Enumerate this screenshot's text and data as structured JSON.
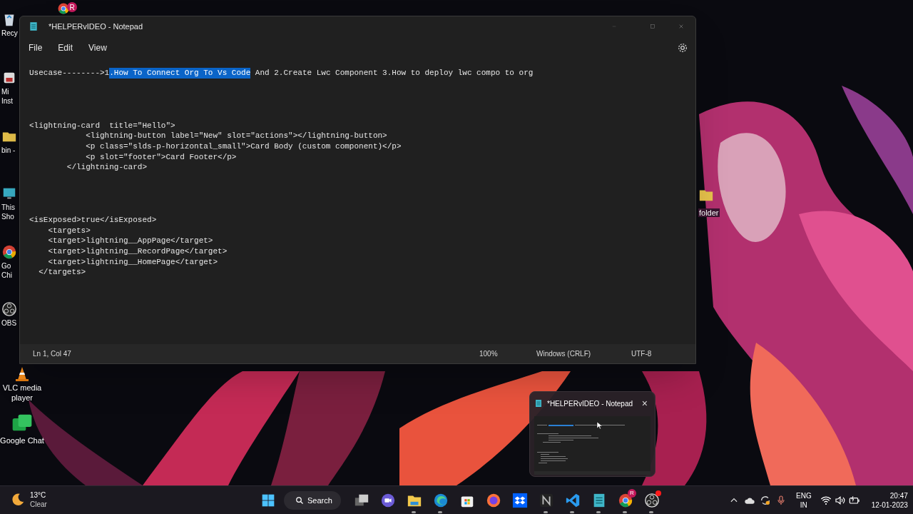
{
  "desktop_icons": [
    {
      "kind": "recycle",
      "label": "Recy"
    },
    {
      "kind": "installer",
      "label": "Mi\nInst"
    },
    {
      "kind": "folder",
      "label": "bin -"
    },
    {
      "kind": "pc",
      "label": "This\nSho"
    },
    {
      "kind": "chrome",
      "label": "Go\nChi"
    },
    {
      "kind": "obs",
      "label": "OBS"
    },
    {
      "kind": "vlc",
      "label": "VLC media\nplayer"
    },
    {
      "kind": "chat",
      "label": "Google Chat"
    }
  ],
  "desktop_chrome_badge": "R",
  "desktop_folder_label": "folder",
  "window": {
    "title": "*HELPERvIDEO - Notepad",
    "menu": [
      "File",
      "Edit",
      "View"
    ],
    "editor": {
      "first_line": [
        {
          "text": "Usecase-------->1",
          "selected": false
        },
        {
          "text": ".How To Connect Org To Vs Code",
          "selected": true
        },
        {
          "text": " And 2.Create Lwc Component 3.How to deploy lwc compo to org",
          "selected": false
        }
      ],
      "blocks": [
        [
          "<lightning-card  title=\"Hello\">",
          "            <lightning-button label=\"New\" slot=\"actions\"></lightning-button>",
          "            <p class=\"slds-p-horizontal_small\">Card Body (custom component)</p>",
          "            <p slot=\"footer\">Card Footer</p>",
          "        </lightning-card>"
        ],
        [
          "<isExposed>true</isExposed>",
          "    <targets>",
          "    <target>lightning__AppPage</target>",
          "    <target>lightning__RecordPage</target>",
          "    <target>lightning__HomePage</target>",
          "  </targets>"
        ]
      ]
    },
    "status_bar": {
      "position": "Ln 1, Col 47",
      "zoom": "100%",
      "line_ending": "Windows (CRLF)",
      "encoding": "UTF-8"
    }
  },
  "preview": {
    "title": "*HELPERvIDEO - Notepad",
    "close": "×"
  },
  "taskbar": {
    "weather": {
      "temp": "13°C",
      "condition": "Clear"
    },
    "search": "Search",
    "apps": [
      {
        "kind": "taskview",
        "running": false
      },
      {
        "kind": "meet",
        "running": false
      },
      {
        "kind": "explorer",
        "running": true
      },
      {
        "kind": "edge",
        "running": true
      },
      {
        "kind": "store",
        "running": false
      },
      {
        "kind": "firefox",
        "running": false
      },
      {
        "kind": "dropbox",
        "running": false
      },
      {
        "kind": "napp",
        "running": true
      },
      {
        "kind": "vscode",
        "running": true
      },
      {
        "kind": "notepad",
        "running": true
      },
      {
        "kind": "chrome",
        "running": true,
        "badge": "R"
      },
      {
        "kind": "obs",
        "running": true,
        "notification": true
      }
    ],
    "language": {
      "top": "ENG",
      "bottom": "IN"
    },
    "time": "20:47",
    "date": "12-01-2023"
  }
}
